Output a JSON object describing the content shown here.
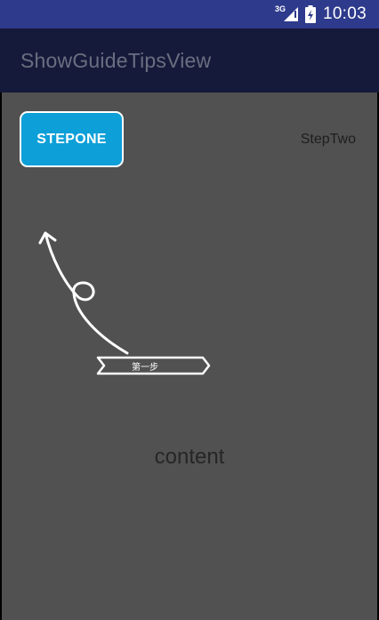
{
  "status_bar": {
    "network_label": "3G",
    "time": "10:03",
    "icons": [
      "signal-icon",
      "battery-icon"
    ]
  },
  "app_bar": {
    "title": "ShowGuideTipsView"
  },
  "buttons": {
    "step_one": "STEPONE",
    "step_two": "StepTwo"
  },
  "guide_tip": {
    "label": "第一步"
  },
  "main": {
    "content_text": "content"
  },
  "colors": {
    "status_bar": "#2e3a8c",
    "app_bar": "#161a3a",
    "overlay": "#515151",
    "accent": "#0d9fd8"
  }
}
